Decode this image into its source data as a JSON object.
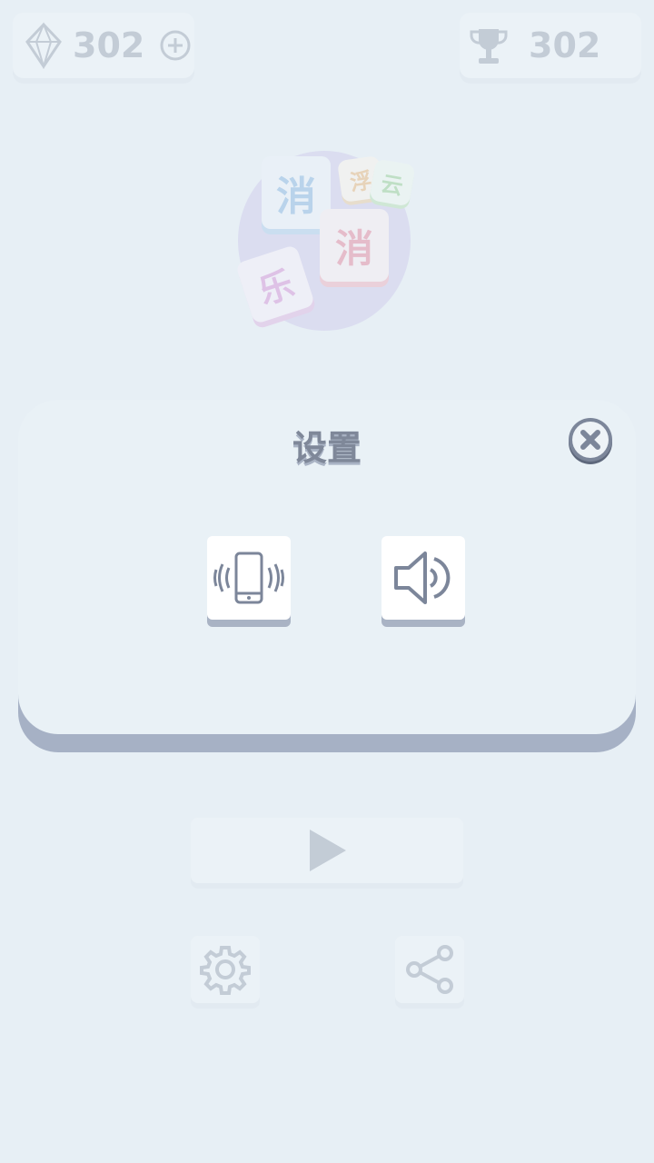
{
  "top_bar": {
    "gems": {
      "value": "302",
      "icon": "diamond-icon",
      "add_icon": "plus-circle-icon"
    },
    "high_score": {
      "value": "302",
      "icon": "trophy-icon"
    }
  },
  "logo": {
    "tiles": [
      "消",
      "浮",
      "云",
      "消",
      "乐"
    ]
  },
  "dialog": {
    "title": "设置",
    "close_icon": "close-icon",
    "toggles": [
      {
        "name": "vibration",
        "icon": "phone-vibrate-icon"
      },
      {
        "name": "sound",
        "icon": "speaker-icon"
      }
    ]
  },
  "main_menu": {
    "play_icon": "play-icon",
    "settings_icon": "gear-icon",
    "share_icon": "share-icon"
  },
  "colors": {
    "background": "#e7eff5",
    "dialog": "#e9f1f6",
    "dialog_shadow": "#a6b1c5",
    "icon": "#7c869a"
  }
}
